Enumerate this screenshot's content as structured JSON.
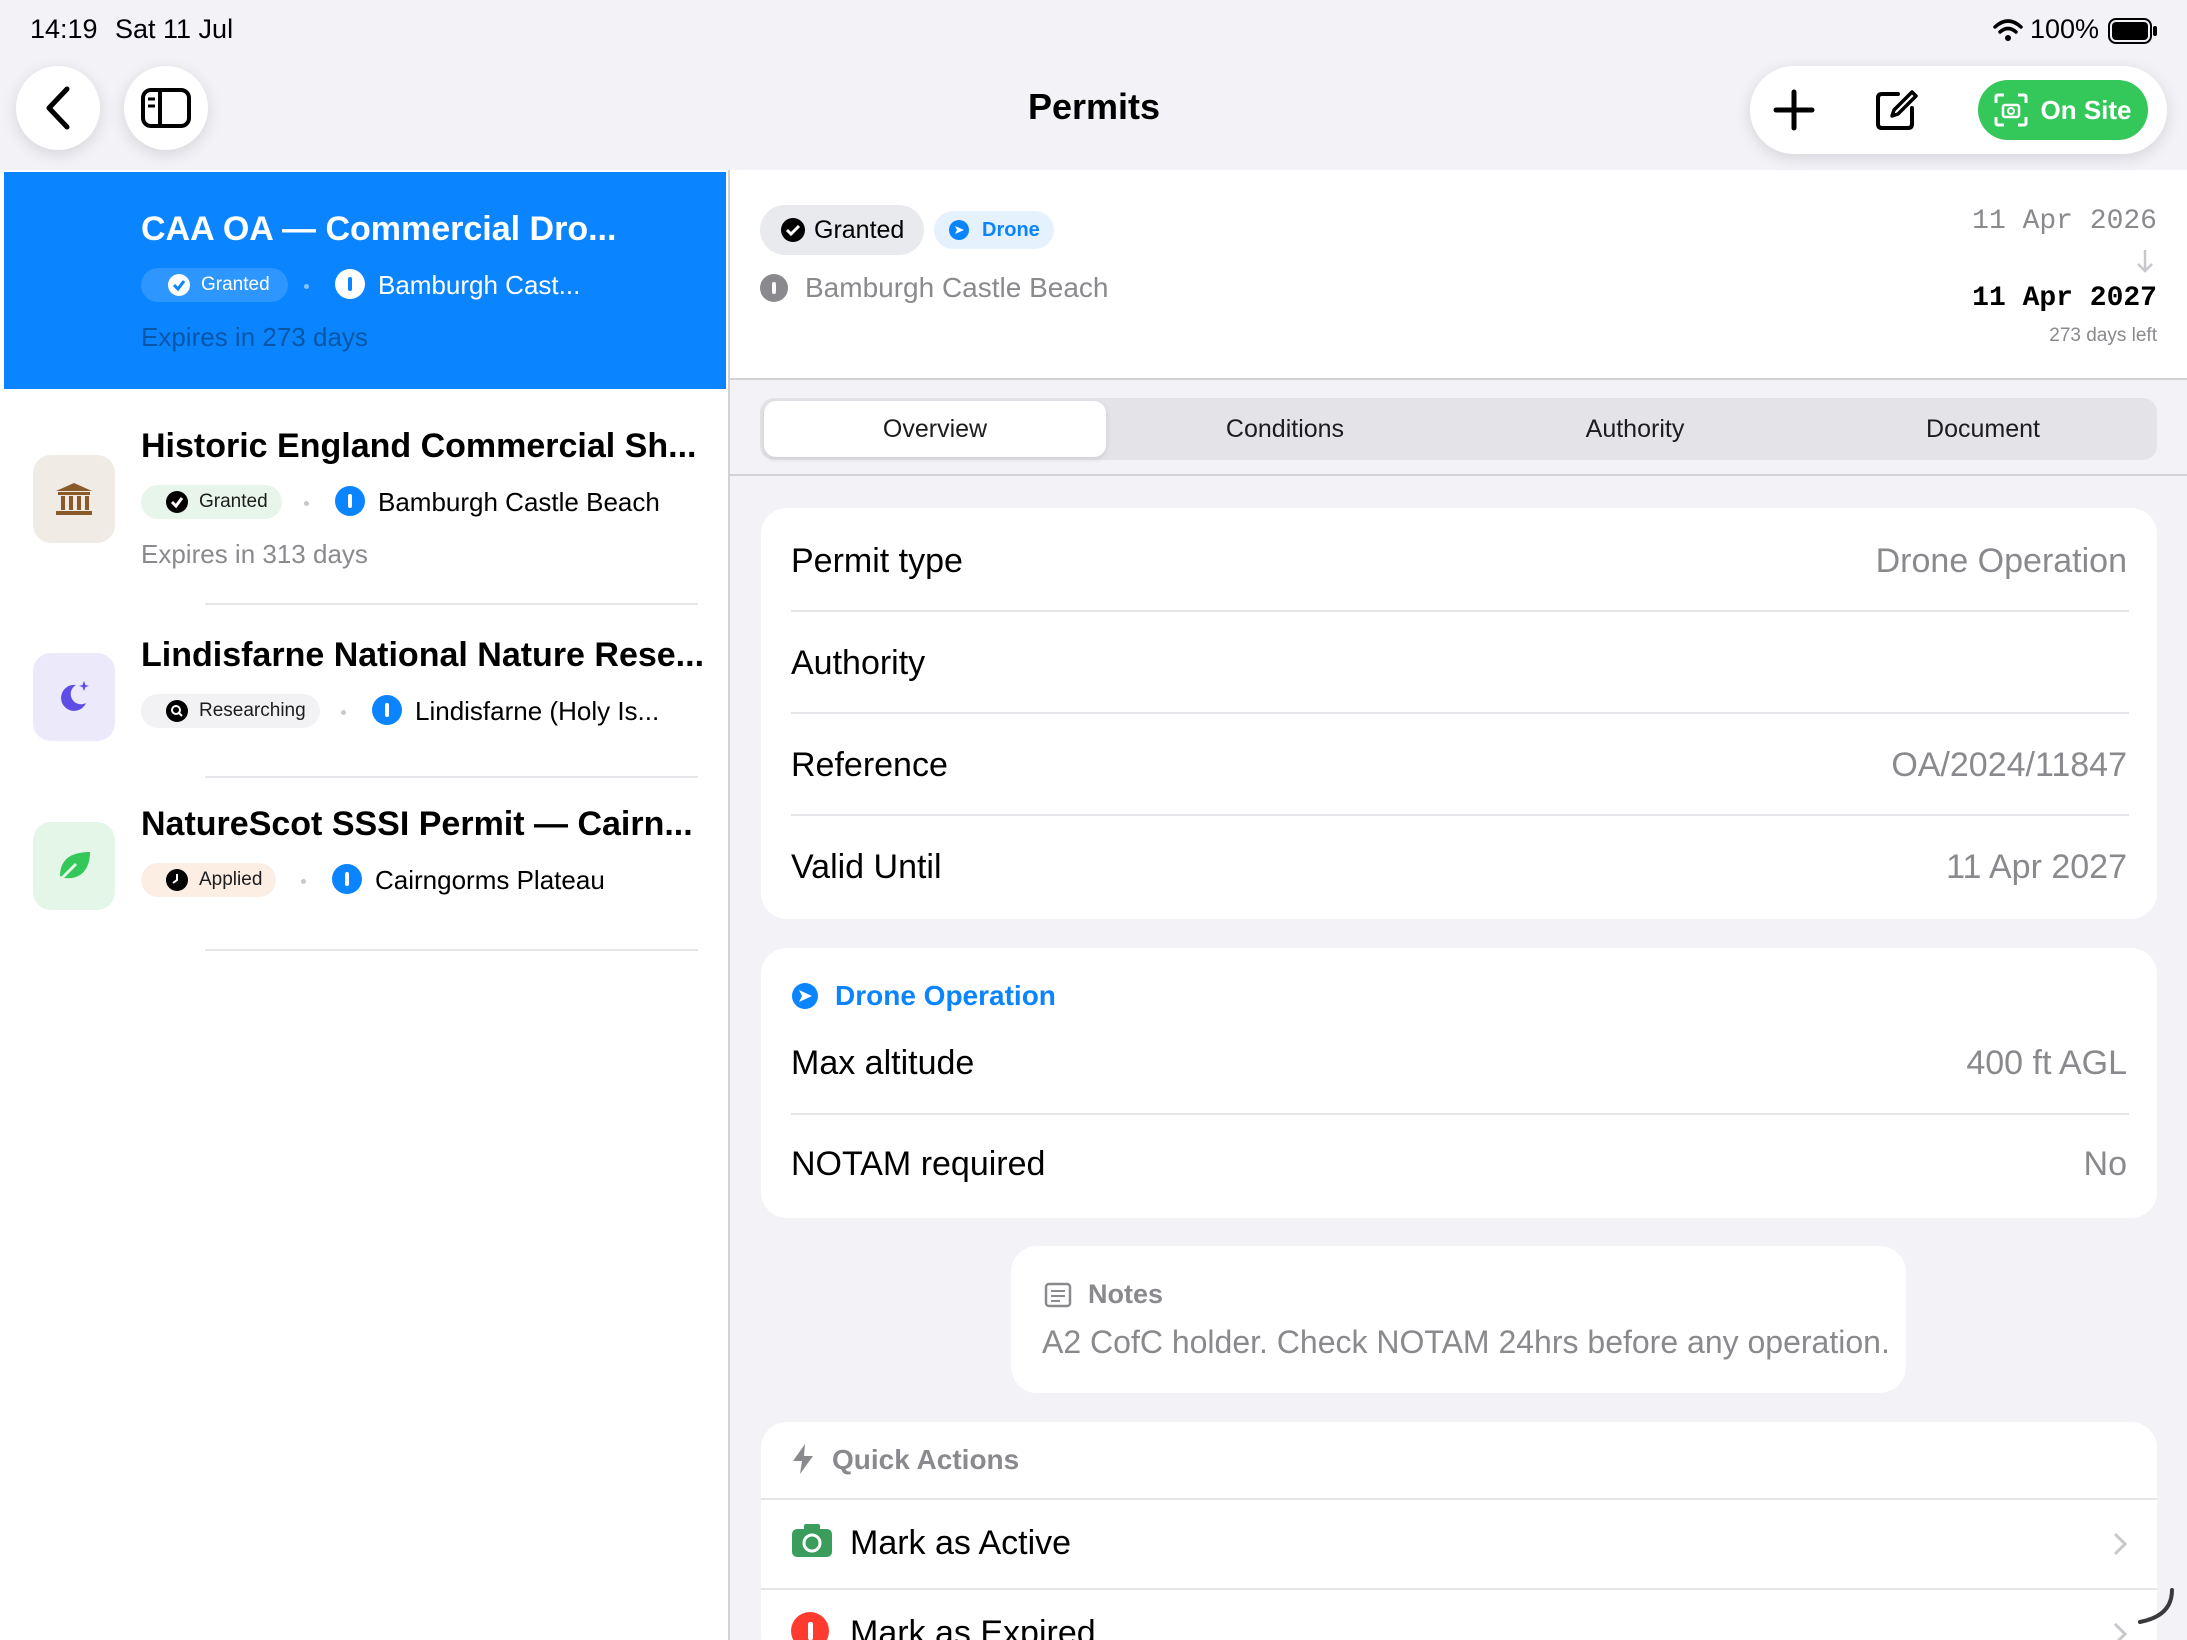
{
  "status_bar": {
    "time": "14:19",
    "date": "Sat 11 Jul",
    "battery": "100%"
  },
  "nav": {
    "title": "Permits",
    "on_site_label": "On Site",
    "accent": "#34c759"
  },
  "list": [
    {
      "title": "CAA OA — Commercial Dro...",
      "status": "Granted",
      "location": "Bamburgh Cast...",
      "expiry": "Expires in 273 days",
      "icon": "drone-icon",
      "selected": true
    },
    {
      "title": "Historic England Commercial Sh...",
      "status": "Granted",
      "location": "Bamburgh Castle Beach",
      "expiry": "Expires in 313 days",
      "icon": "building-columns-icon"
    },
    {
      "title": "Lindisfarne National Nature Rese...",
      "status": "Researching",
      "location": "Lindisfarne (Holy Is...",
      "icon": "moon-stars-icon"
    },
    {
      "title": "NatureScot SSSI Permit — Cairn...",
      "status": "Applied",
      "location": "Cairngorms Plateau",
      "icon": "leaf-icon"
    }
  ],
  "detail": {
    "status": "Granted",
    "category": "Drone",
    "location": "Bamburgh Castle Beach",
    "start_date": "11 Apr 2026",
    "end_date": "11 Apr 2027",
    "days_left": "273 days left",
    "tabs": [
      "Overview",
      "Conditions",
      "Authority",
      "Document"
    ],
    "active_tab": "Overview",
    "fields": [
      {
        "label": "Permit type",
        "value": "Drone Operation"
      },
      {
        "label": "Authority",
        "value": ""
      },
      {
        "label": "Reference",
        "value": "OA/2024/11847"
      },
      {
        "label": "Valid Until",
        "value": "11 Apr 2027"
      }
    ],
    "drone_section": {
      "title": "Drone Operation",
      "rows": [
        {
          "label": "Max altitude",
          "value": "400 ft AGL"
        },
        {
          "label": "NOTAM required",
          "value": "No"
        }
      ]
    },
    "notes": {
      "title": "Notes",
      "text": "A2 CofC holder. Check NOTAM 24hrs before any operation."
    },
    "quick_actions": {
      "title": "Quick Actions",
      "items": [
        {
          "label": "Mark as Active",
          "icon": "camera-icon"
        },
        {
          "label": "Mark as Expired",
          "icon": "alert-icon"
        }
      ]
    }
  },
  "colors": {
    "selected": "#0a84ff",
    "blue": "#0a84ff",
    "secondary": "#8a8a8e"
  }
}
